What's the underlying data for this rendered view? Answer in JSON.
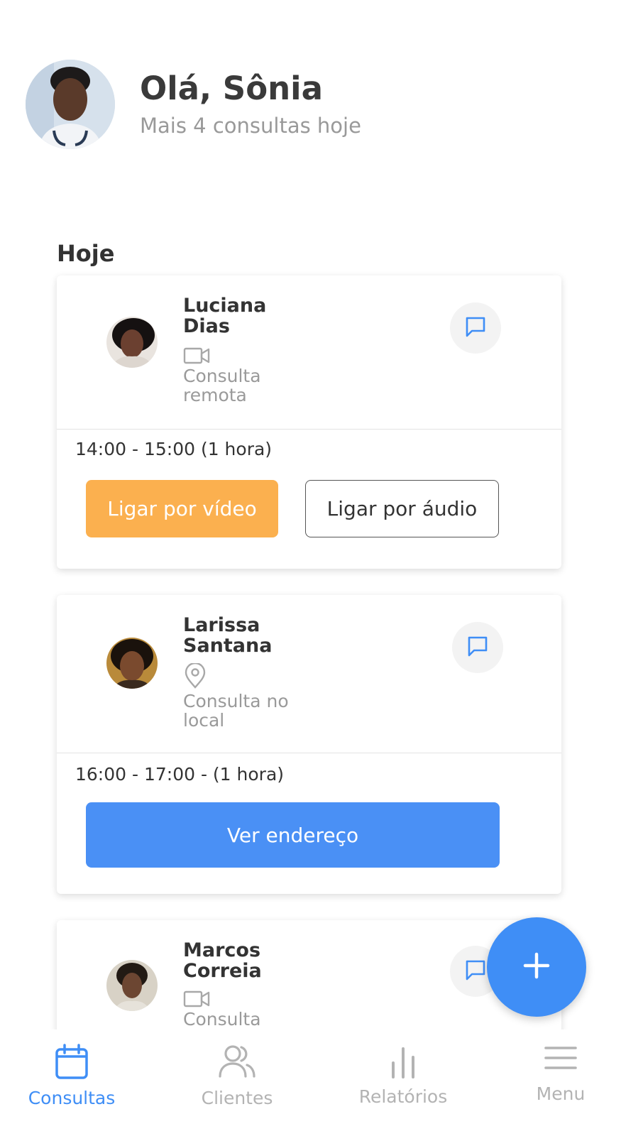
{
  "header": {
    "greeting": "Olá, Sônia",
    "subtitle": "Mais 4 consultas hoje"
  },
  "section_title": "Hoje",
  "appointments": [
    {
      "name": "Luciana\nDias",
      "type_icon": "video-camera-icon",
      "type_label": "Consulta remota",
      "time": "14:00 - 15:00 (1 hora)",
      "video_button": "Ligar por vídeo",
      "audio_button": "Ligar por áudio"
    },
    {
      "name": "Larissa\nSantana",
      "type_icon": "location-pin-icon",
      "type_label": "Consulta no local",
      "time": "16:00 - 17:00 - (1 hora)",
      "address_button": "Ver endereço"
    },
    {
      "name": "Marcos\nCorreia",
      "type_icon": "video-camera-icon",
      "type_label": "Consulta"
    }
  ],
  "fab": {
    "icon": "plus-icon"
  },
  "nav": {
    "items": [
      {
        "label": "Consultas",
        "icon": "calendar-icon",
        "active": true
      },
      {
        "label": "Clientes",
        "icon": "users-icon",
        "active": false
      },
      {
        "label": "Relatórios",
        "icon": "bar-chart-icon",
        "active": false
      },
      {
        "label": "Menu",
        "icon": "hamburger-menu-icon",
        "active": false
      }
    ]
  },
  "colors": {
    "accent": "#3f8ef6",
    "video_button": "#fbb04f",
    "inactive_nav": "#b3b3b3"
  }
}
